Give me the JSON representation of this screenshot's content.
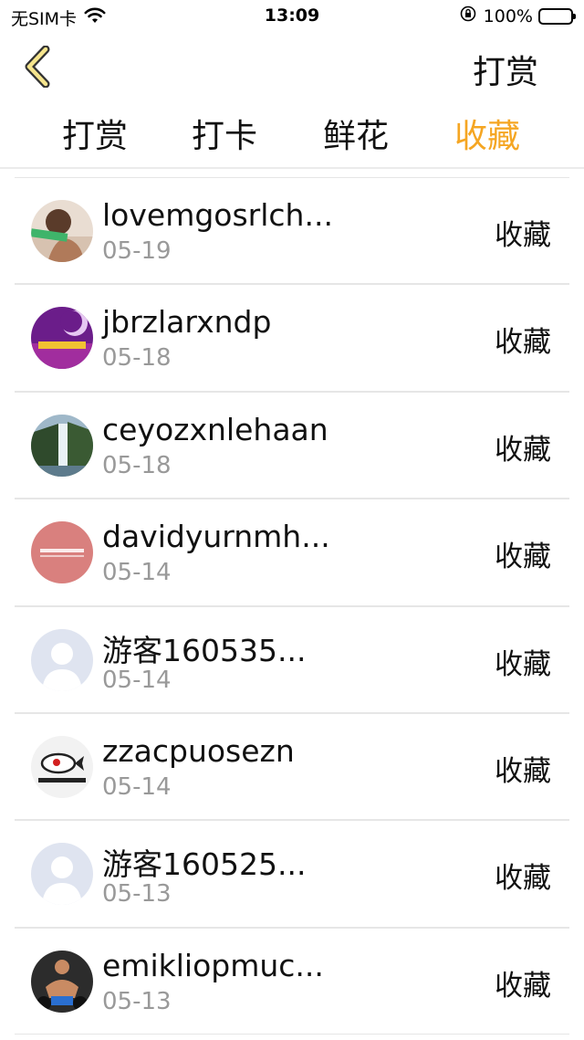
{
  "status_bar": {
    "carrier": "无SIM卡",
    "time": "13:09",
    "battery": "100%"
  },
  "nav": {
    "title": "打赏",
    "accent_color": "#f5a623"
  },
  "tabs": [
    {
      "label": "打赏",
      "active": false
    },
    {
      "label": "打卡",
      "active": false
    },
    {
      "label": "鲜花",
      "active": false
    },
    {
      "label": "收藏",
      "active": true
    }
  ],
  "list": [
    {
      "name": "lovemgosrlch...",
      "date": "05-19",
      "action": "收藏",
      "avatar": "photo-woman"
    },
    {
      "name": "jbrzlarxndp",
      "date": "05-18",
      "action": "收藏",
      "avatar": "purple-moon"
    },
    {
      "name": "ceyozxnlehaan",
      "date": "05-18",
      "action": "收藏",
      "avatar": "waterfall"
    },
    {
      "name": "davidyurnmh...",
      "date": "05-14",
      "action": "收藏",
      "avatar": "red-text-badge"
    },
    {
      "name": "游客160535...",
      "date": "05-14",
      "action": "收藏",
      "avatar": "default-person"
    },
    {
      "name": "zzacpuosezn",
      "date": "05-14",
      "action": "收藏",
      "avatar": "whale-rocket-logo"
    },
    {
      "name": "游客160525...",
      "date": "05-13",
      "action": "收藏",
      "avatar": "default-person"
    },
    {
      "name": "emikliopmuc...",
      "date": "05-13",
      "action": "收藏",
      "avatar": "photo-athlete"
    }
  ]
}
